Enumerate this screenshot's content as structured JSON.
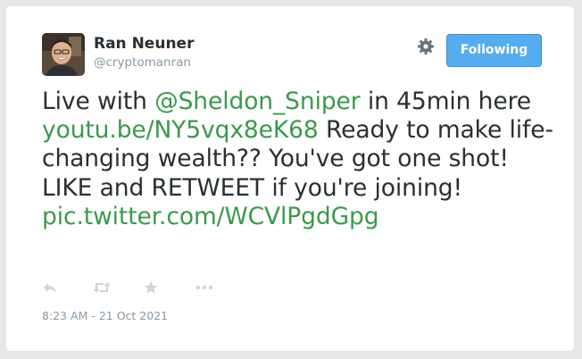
{
  "user": {
    "name": "Ran Neuner",
    "handle": "@cryptomanran"
  },
  "follow_button": {
    "label": "Following",
    "color": "#55acee"
  },
  "tweet": {
    "segments": [
      {
        "text": "Live with ",
        "link": false
      },
      {
        "text": "@Sheldon_Sniper",
        "link": true
      },
      {
        "text": " in 45min here ",
        "link": false
      },
      {
        "text": "youtu.be/NY5vqx8eK68",
        "link": true
      },
      {
        "text": " Ready to make life-changing wealth?? You've got one shot! LIKE and RETWEET if you're joining! ",
        "link": false
      },
      {
        "text": "pic.twitter.com/WCVlPgdGpg",
        "link": true
      }
    ],
    "link_color": "#3a9a4a"
  },
  "actions": {
    "icons": [
      "reply-icon",
      "retweet-icon",
      "favorite-icon",
      "more-icon"
    ]
  },
  "timestamp": "8:23 AM - 21 Oct 2021"
}
